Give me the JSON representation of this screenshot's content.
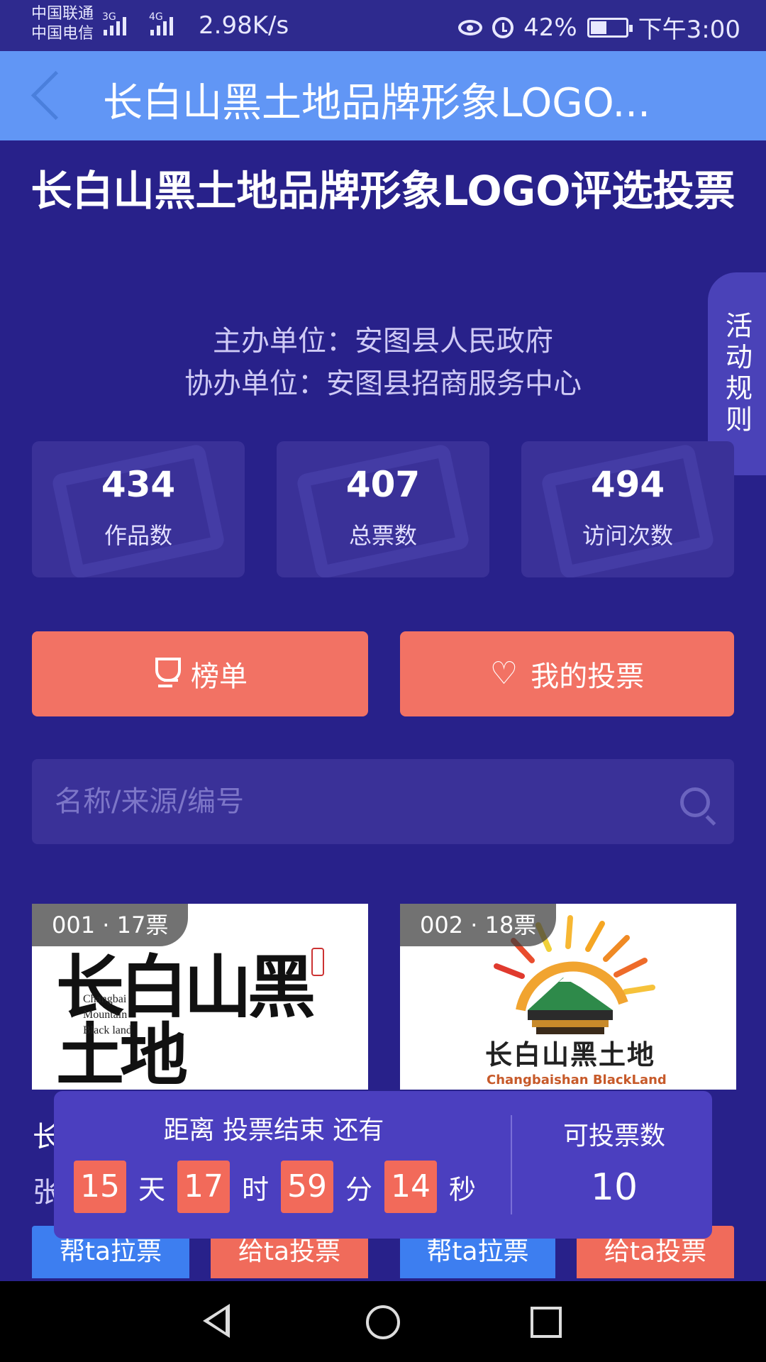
{
  "status": {
    "carrier1": "中国联通",
    "carrier2": "中国电信",
    "net1": "3G",
    "net2": "4G",
    "speed": "2.98K/s",
    "battery": "42%",
    "time": "下午3:00"
  },
  "nav": {
    "title": "长白山黑土地品牌形象LOGO..."
  },
  "hero": {
    "title": "长白山黑土地品牌形象LOGO评选投票",
    "host": "主办单位：安图县人民政府",
    "co_host": "协办单位：安图县招商服务中心"
  },
  "rules_tab": "活动规则",
  "stats": [
    {
      "value": "434",
      "label": "作品数"
    },
    {
      "value": "407",
      "label": "总票数"
    },
    {
      "value": "494",
      "label": "访问次数"
    }
  ],
  "actions": {
    "ranking": "榜单",
    "my_votes": "我的投票"
  },
  "search": {
    "placeholder": "名称/来源/编号"
  },
  "entries": [
    {
      "badge": "001 · 17票",
      "logo_text": "长白山黑土地",
      "logo_en": "Changbai\nMountain\nBlack land",
      "title_partial": "长",
      "author_partial": "张",
      "help_btn": "帮ta拉票",
      "vote_btn": "给ta投票"
    },
    {
      "badge": "002 · 18票",
      "logo_text": "长白山黑土地",
      "logo_en": "Changbaishan BlackLand",
      "help_btn": "帮ta拉票",
      "vote_btn": "给ta投票"
    }
  ],
  "countdown": {
    "heading": "距离 投票结束 还有",
    "days": "15",
    "days_unit": "天",
    "hours": "17",
    "hours_unit": "时",
    "minutes": "59",
    "minutes_unit": "分",
    "seconds": "14",
    "seconds_unit": "秒",
    "remaining_label": "可投票数",
    "remaining_value": "10"
  },
  "colors": {
    "page_bg": "#28218a",
    "nav_bg": "#6196f5",
    "accent_red": "#f27264",
    "accent_blue": "#3d7ef0"
  }
}
